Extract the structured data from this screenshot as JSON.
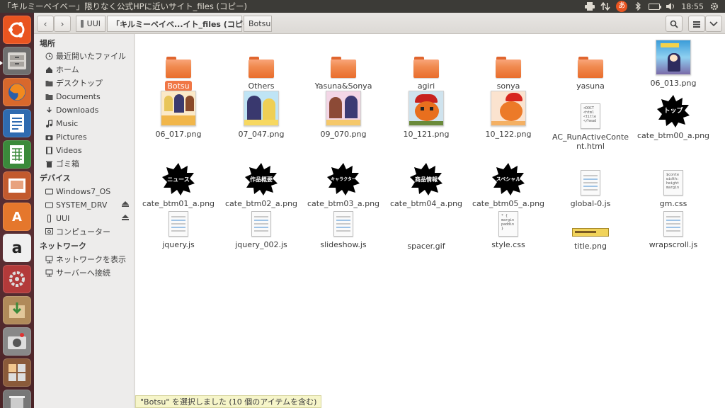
{
  "window_title": "「キルミーベイベー」限りなく公式HPに近いサイト_files (コピー)",
  "panel": {
    "time": "18:55",
    "kb_indicator": "あ",
    "icons": [
      "printer-icon",
      "network-icon",
      "keyboard-icon",
      "bluetooth-icon",
      "battery-icon",
      "volume-icon",
      "gear-icon"
    ]
  },
  "launcher": [
    "ubuntu-dash",
    "files",
    "firefox",
    "writer",
    "calc",
    "impress",
    "software-center",
    "amazon",
    "system-settings",
    "archive",
    "screenshot",
    "workspace-switcher",
    "trash"
  ],
  "toolbar": {
    "back": "‹",
    "forward": "›",
    "crumbs": [
      "UUI",
      "「キルミーベイベ...イト_files (コピー)",
      "Botsu"
    ],
    "search": "search-icon",
    "menu": "menu-icon"
  },
  "sidebar": {
    "places_header": "場所",
    "places": [
      "最近開いたファイル",
      "ホーム",
      "デスクトップ",
      "Documents",
      "Downloads",
      "Music",
      "Pictures",
      "Videos",
      "ゴミ箱"
    ],
    "devices_header": "デバイス",
    "devices": [
      "Windows7_OS",
      "SYSTEM_DRV",
      "UUI",
      "コンピューター"
    ],
    "network_header": "ネットワーク",
    "network": [
      "ネットワークを表示",
      "サーバーへ接続"
    ]
  },
  "files": [
    "Botsu",
    "Others",
    "Yasuna&Sonya",
    "agiri",
    "sonya",
    "yasuna",
    "06_013.png",
    "06_017.png",
    "07_047.png",
    "09_070.png",
    "10_121.png",
    "10_122.png",
    "AC_RunActiveContent.html",
    "cate_btm00_a.png",
    "cate_btm01_a.png",
    "cate_btm02_a.png",
    "cate_btm03_a.png",
    "cate_btm04_a.png",
    "cate_btm05_a.png",
    "global-0.js",
    "gm.css",
    "jquery.js",
    "jquery_002.js",
    "slideshow.js",
    "spacer.gif",
    "style.css",
    "title.png",
    "wrapscroll.js"
  ],
  "badges": [
    "トップ",
    "ニュース",
    "作品概要",
    "キャラクター",
    "商品情報",
    "スペシャル"
  ],
  "doc_previews": {
    "html": [
      "<DOCT",
      "<html",
      "<title",
      "</head"
    ],
    "css_gm": [
      "$conte",
      "width:",
      "height",
      "margin"
    ],
    "css_style": [
      "* {",
      "margin",
      "paddin",
      "}"
    ]
  },
  "status": "\"Botsu\" を選択しました (10 個のアイテムを含む)",
  "colors": {
    "panel": "#3c3b37",
    "folder": "#f08a4f",
    "selection": "#f07746",
    "status_bg": "#f6f5c9"
  }
}
